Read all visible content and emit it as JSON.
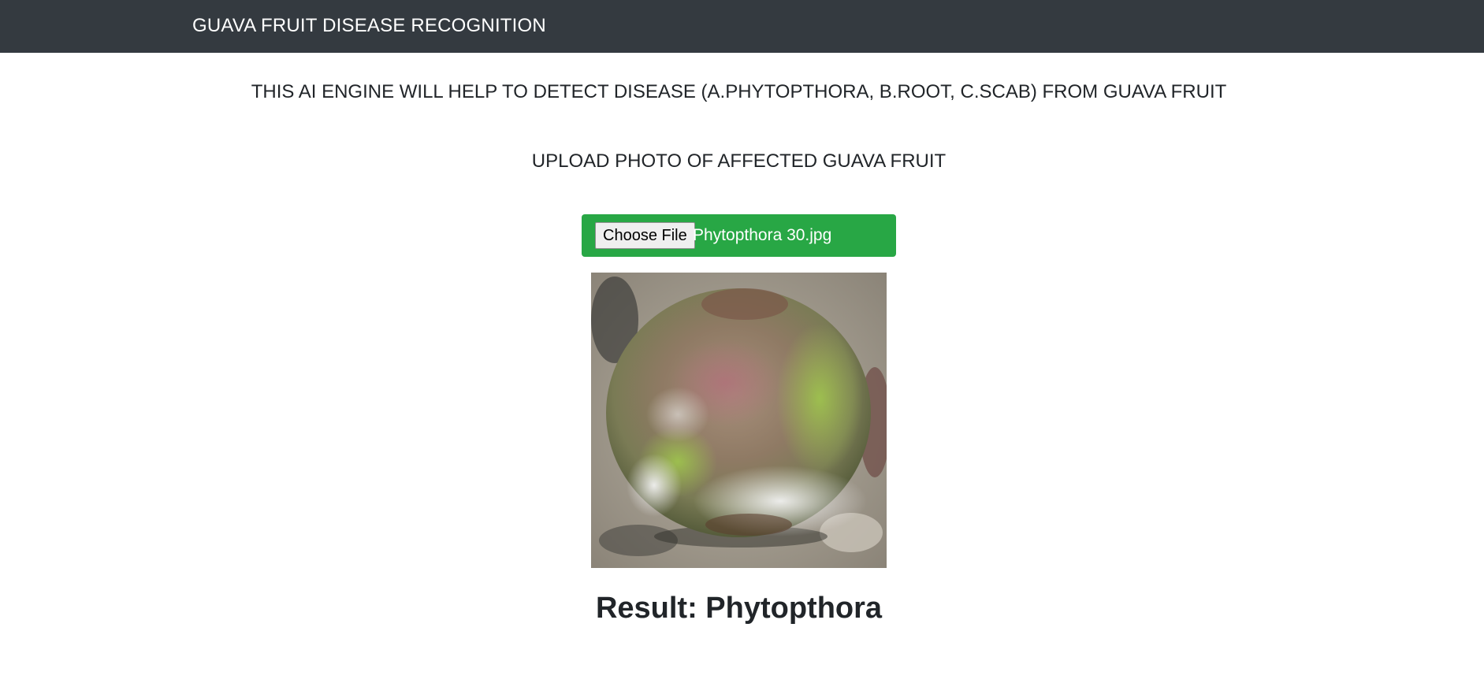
{
  "navbar": {
    "brand": "GUAVA FRUIT DISEASE RECOGNITION"
  },
  "main": {
    "intro": "THIS AI ENGINE WILL HELP TO DETECT DISEASE (A.PHYTOPTHORA, B.ROOT, C.SCAB) FROM GUAVA FRUIT",
    "upload_label": "UPLOAD PHOTO OF AFFECTED GUAVA FRUIT",
    "file_input": {
      "button_label": "Choose File",
      "file_name": "Phytopthora 30.jpg"
    },
    "result": "Result: Phytopthora"
  },
  "colors": {
    "navbar_bg": "#343a40",
    "upload_bg": "#28a745"
  },
  "icons": {
    "photo": "guava-fruit-photo"
  }
}
